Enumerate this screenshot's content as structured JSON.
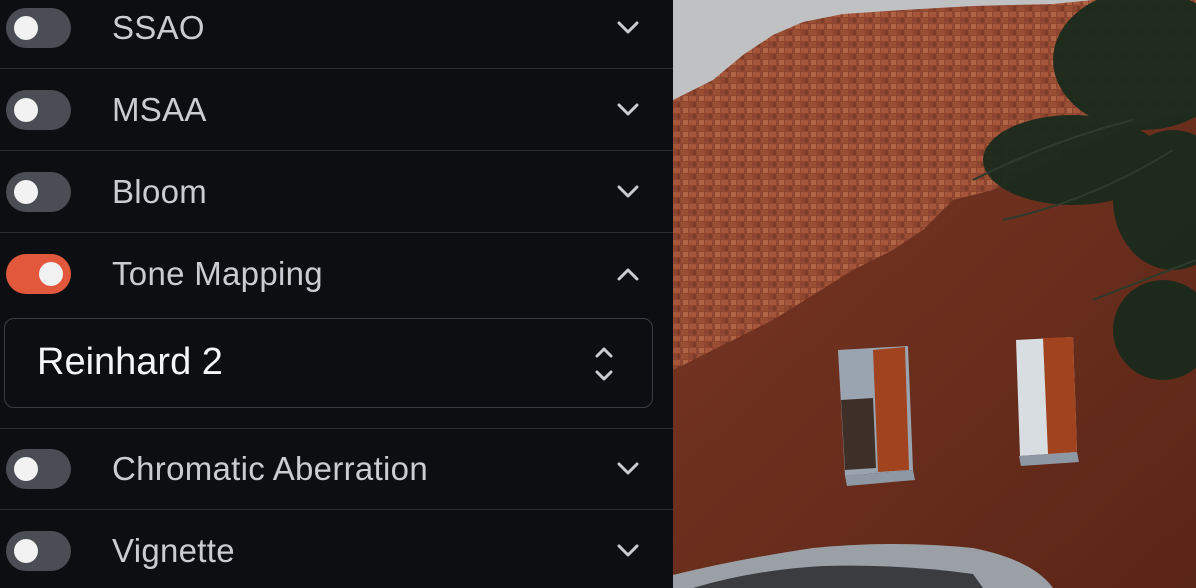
{
  "settings": {
    "ssao": {
      "label": "SSAO",
      "enabled": false,
      "expanded": false
    },
    "msaa": {
      "label": "MSAA",
      "enabled": false,
      "expanded": false
    },
    "bloom": {
      "label": "Bloom",
      "enabled": false,
      "expanded": false
    },
    "tone_mapping": {
      "label": "Tone Mapping",
      "enabled": true,
      "expanded": true,
      "mode_value": "Reinhard 2"
    },
    "chromatic_aberration": {
      "label": "Chromatic Aberration",
      "enabled": false,
      "expanded": false
    },
    "vignette": {
      "label": "Vignette",
      "enabled": false,
      "expanded": false
    }
  },
  "icons": {
    "collapsed": "chevron-down-icon",
    "expanded": "chevron-up-icon",
    "select": "up-down-arrows-icon"
  },
  "colors": {
    "panel_bg": "#0d0e11",
    "toggle_off": "#4a4d53",
    "toggle_on": "#e2583c",
    "label_text": "#c9ccd1",
    "divider": "#2a2c31"
  }
}
